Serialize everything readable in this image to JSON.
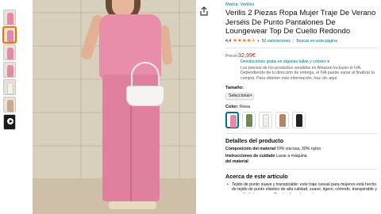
{
  "product": {
    "brand_link": "Marca: Veriliss",
    "title": "Verilis 2 Piezas Ropa Mujer Traje De Verano Jerséis De Punto Pantalones De Loungewear Top De Cuello Redondo",
    "rating_value": "4,4",
    "rating_stars": 4.4,
    "ratings_count": "50 valoraciones",
    "search_link": "Buscar en esta página"
  },
  "pricing": {
    "label": "Precio:",
    "price": "32,99€",
    "returns": "Devoluciones gratis en algunas tallas y colores ▾",
    "vat_note": "Los precios de los productos vendidos en Amazon incluyen el IVA. Dependiendo de tu dirección de entrega, el IVA puede variar al finalizar la compra. Para obtener más información, haz clic ",
    "vat_link": "aquí."
  },
  "size": {
    "label": "Tamaño:",
    "selected": "Seleccionar"
  },
  "color": {
    "label": "Color:",
    "selected": "Rosa",
    "swatches": [
      "#e58aa6",
      "#6f8a52",
      "#f2eee8",
      "#b08868",
      "#222222"
    ]
  },
  "details": {
    "heading": "Detalles del producto",
    "rows": [
      {
        "key": "Composición del material",
        "value": "70% viscosa, 30% nylon"
      },
      {
        "key": "Instrucciones de cuidado del material",
        "value": "Lavar a máquina"
      }
    ]
  },
  "about": {
    "heading": "Acerca de este artículo",
    "bullet": "Tejido de punto suave y transpirable: este traje casual para mujeres está hecho de tejido de punto elástico de alta calidad, suave, ligero, cómodo, transpirable y no es fácil de encoger. Puede ofrecerle una buena"
  },
  "icons": {
    "share": "share-icon",
    "dropdown": "chevron-down-icon",
    "play": "play-icon"
  }
}
